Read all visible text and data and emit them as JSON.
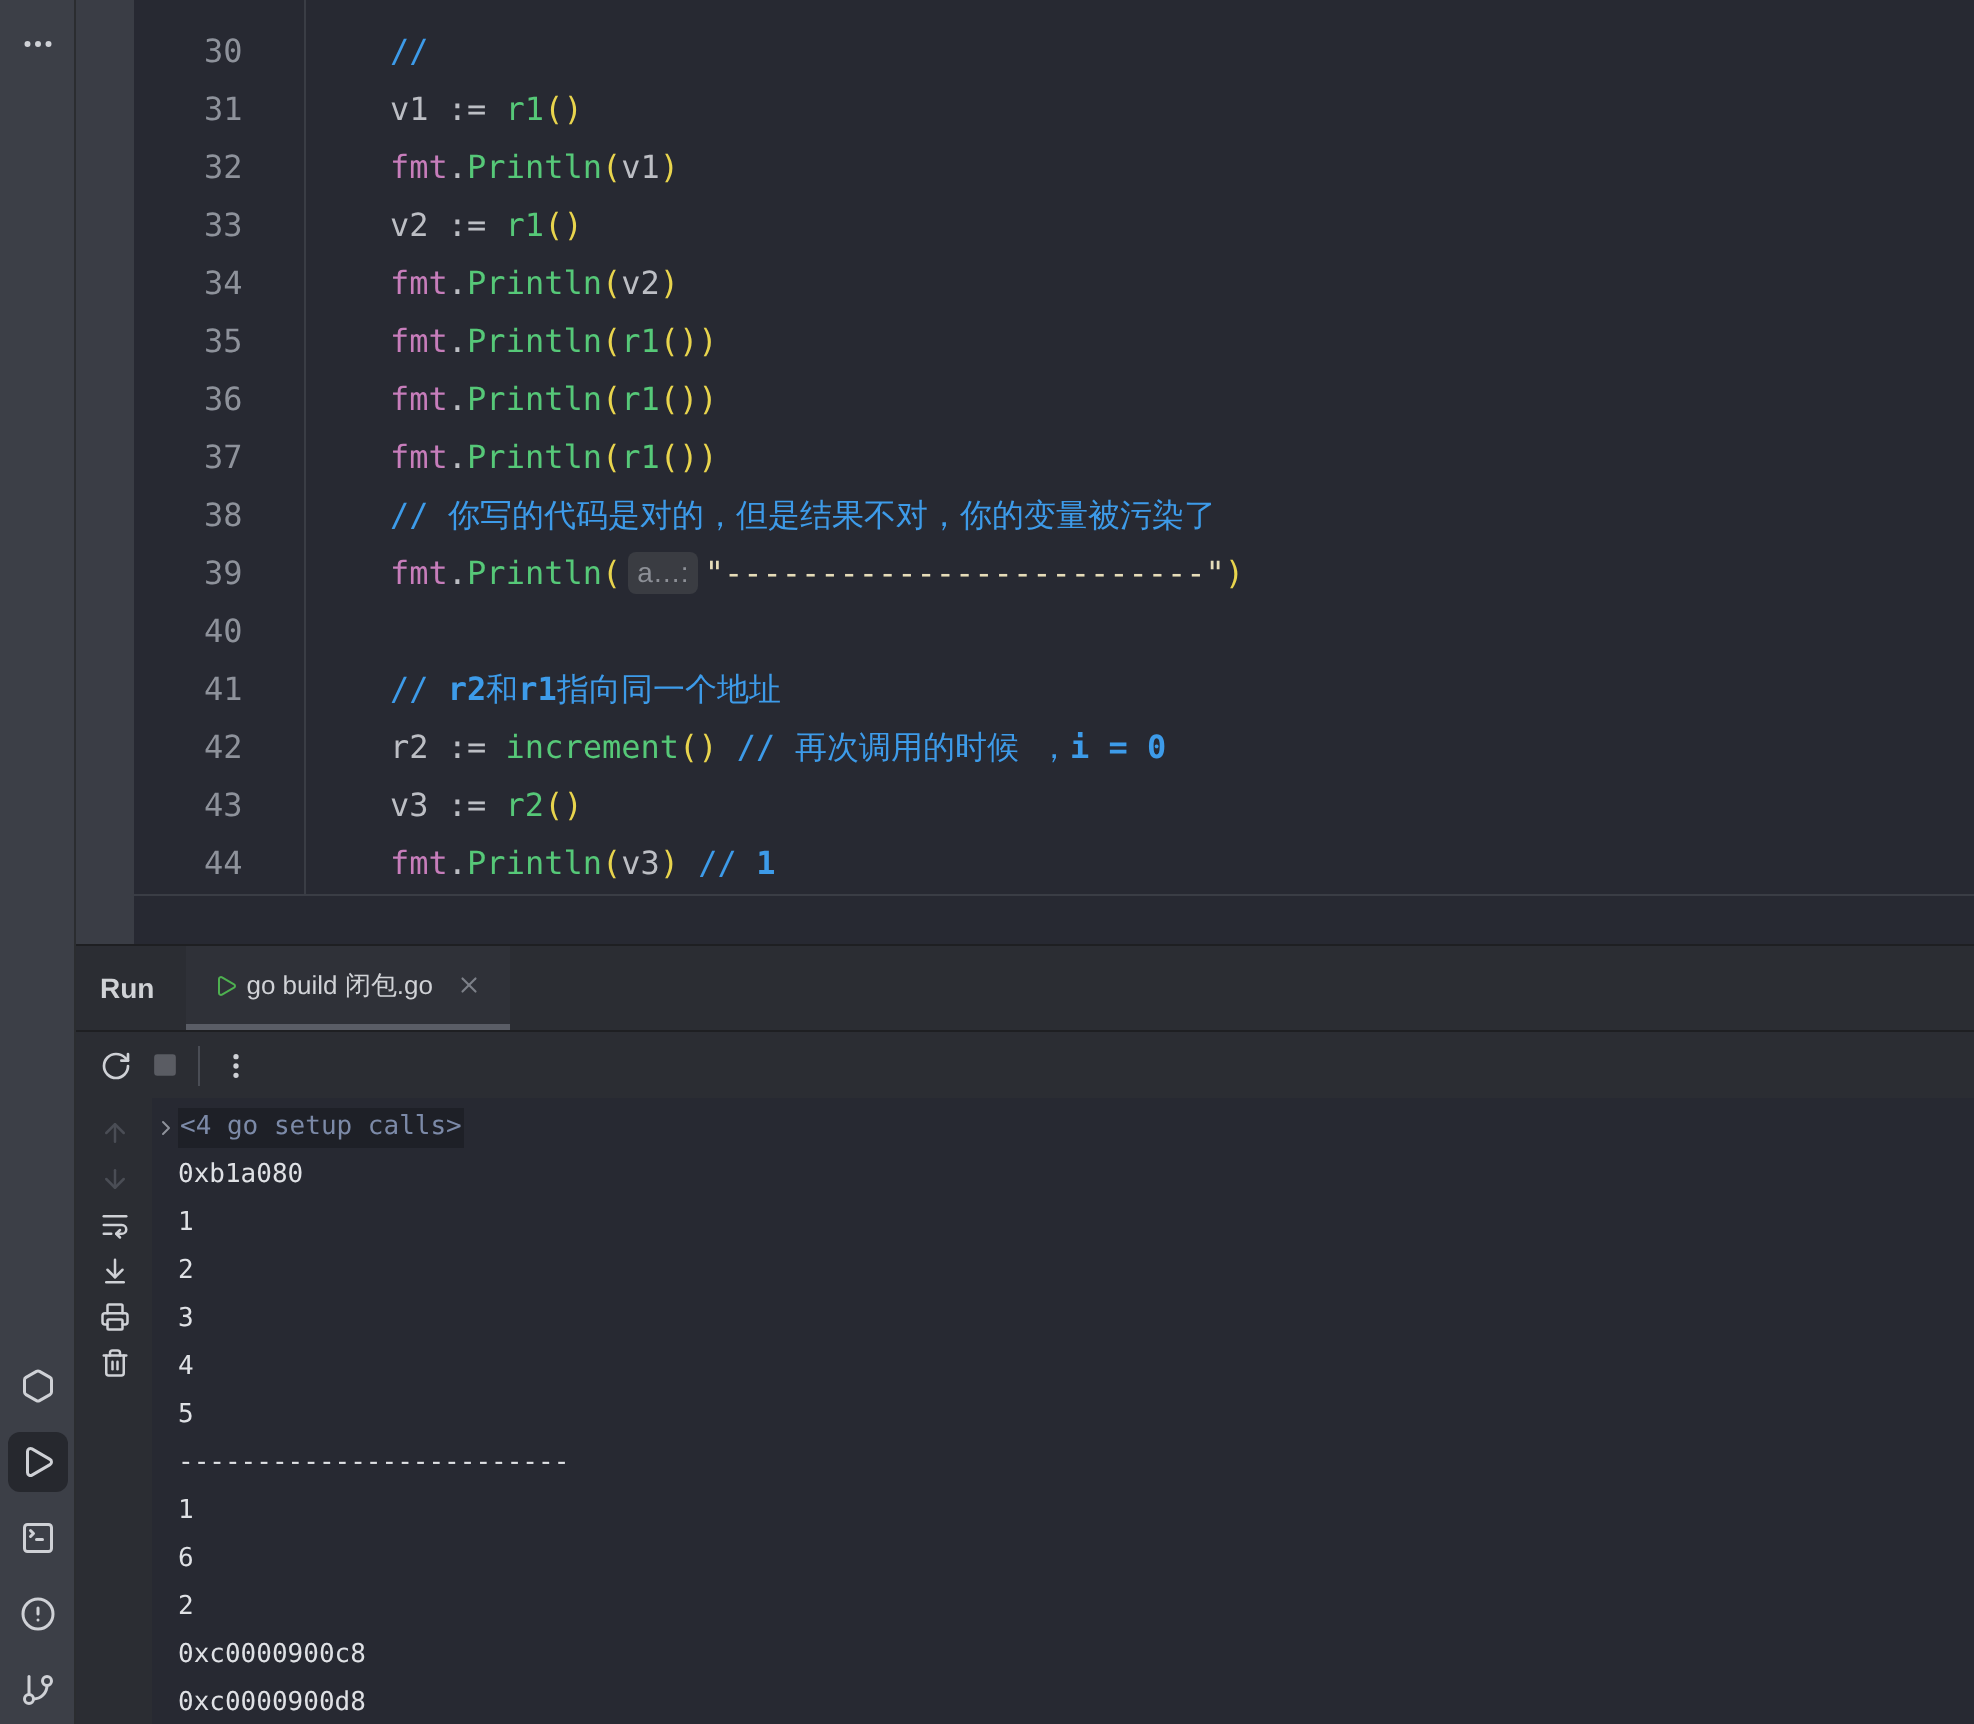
{
  "code_lines": [
    {
      "number": "30",
      "tokens": [
        {
          "kind": "comment",
          "text": "//"
        }
      ]
    },
    {
      "number": "31",
      "tokens": [
        {
          "kind": "ident",
          "text": "v1 := "
        },
        {
          "kind": "func",
          "text": "r1"
        },
        {
          "kind": "paren",
          "text": "()"
        }
      ]
    },
    {
      "number": "32",
      "tokens": [
        {
          "kind": "pkg",
          "text": "fmt"
        },
        {
          "kind": "ident",
          "text": "."
        },
        {
          "kind": "func",
          "text": "Println"
        },
        {
          "kind": "paren",
          "text": "("
        },
        {
          "kind": "ident",
          "text": "v1"
        },
        {
          "kind": "paren",
          "text": ")"
        }
      ]
    },
    {
      "number": "33",
      "tokens": [
        {
          "kind": "ident",
          "text": "v2 := "
        },
        {
          "kind": "func",
          "text": "r1"
        },
        {
          "kind": "paren",
          "text": "()"
        }
      ]
    },
    {
      "number": "34",
      "tokens": [
        {
          "kind": "pkg",
          "text": "fmt"
        },
        {
          "kind": "ident",
          "text": "."
        },
        {
          "kind": "func",
          "text": "Println"
        },
        {
          "kind": "paren",
          "text": "("
        },
        {
          "kind": "ident",
          "text": "v2"
        },
        {
          "kind": "paren",
          "text": ")"
        }
      ]
    },
    {
      "number": "35",
      "tokens": [
        {
          "kind": "pkg",
          "text": "fmt"
        },
        {
          "kind": "ident",
          "text": "."
        },
        {
          "kind": "func",
          "text": "Println"
        },
        {
          "kind": "paren",
          "text": "("
        },
        {
          "kind": "func",
          "text": "r1"
        },
        {
          "kind": "paren",
          "text": "())"
        }
      ]
    },
    {
      "number": "36",
      "tokens": [
        {
          "kind": "pkg",
          "text": "fmt"
        },
        {
          "kind": "ident",
          "text": "."
        },
        {
          "kind": "func",
          "text": "Println"
        },
        {
          "kind": "paren",
          "text": "("
        },
        {
          "kind": "func",
          "text": "r1"
        },
        {
          "kind": "paren",
          "text": "())"
        }
      ]
    },
    {
      "number": "37",
      "tokens": [
        {
          "kind": "pkg",
          "text": "fmt"
        },
        {
          "kind": "ident",
          "text": "."
        },
        {
          "kind": "func",
          "text": "Println"
        },
        {
          "kind": "paren",
          "text": "("
        },
        {
          "kind": "func",
          "text": "r1"
        },
        {
          "kind": "paren",
          "text": "())"
        }
      ]
    },
    {
      "number": "38",
      "tokens": [
        {
          "kind": "comment",
          "text": "// 你写的代码是对的，但是结果不对，你的变量被污染了"
        }
      ]
    },
    {
      "number": "39",
      "tokens": [
        {
          "kind": "pkg",
          "text": "fmt"
        },
        {
          "kind": "ident",
          "text": "."
        },
        {
          "kind": "func",
          "text": "Println"
        },
        {
          "kind": "paren",
          "text": "("
        },
        {
          "kind": "hint",
          "text": "a…:"
        },
        {
          "kind": "string",
          "text": "\"-------------------------\""
        },
        {
          "kind": "paren",
          "text": ")"
        }
      ]
    },
    {
      "number": "40"
    },
    {
      "number": "41",
      "tokens": [
        {
          "kind": "comment",
          "text": "// **r2**和**r1**指向同一个地址"
        }
      ]
    },
    {
      "number": "42",
      "tokens": [
        {
          "kind": "ident",
          "text": "r2 := "
        },
        {
          "kind": "func",
          "text": "increment"
        },
        {
          "kind": "paren",
          "text": "()"
        },
        {
          "kind": "comment",
          "text": " // 再次调用的时候 ，**i = 0**"
        }
      ]
    },
    {
      "number": "43",
      "tokens": [
        {
          "kind": "ident",
          "text": "v3 := "
        },
        {
          "kind": "func",
          "text": "r2"
        },
        {
          "kind": "paren",
          "text": "()"
        }
      ]
    },
    {
      "number": "44",
      "tokens": [
        {
          "kind": "pkg",
          "text": "fmt"
        },
        {
          "kind": "ident",
          "text": "."
        },
        {
          "kind": "func",
          "text": "Println"
        },
        {
          "kind": "paren",
          "text": "("
        },
        {
          "kind": "ident",
          "text": "v3"
        },
        {
          "kind": "paren",
          "text": ")"
        },
        {
          "kind": "comment",
          "text": " // **1**"
        }
      ]
    }
  ],
  "run_panel": {
    "title": "Run",
    "tabs": [
      {
        "label": "go build 闭包.go",
        "selected": true
      }
    ],
    "folded_group": "<4 go setup calls>",
    "output": [
      "0xb1a080",
      "1",
      "2",
      "3",
      "4",
      "5",
      "-------------------------",
      "1",
      "6",
      "2",
      "0xc0000900c8",
      "0xc0000900d8"
    ]
  },
  "tool_strip": [
    {
      "kind": "services",
      "selected": false
    },
    {
      "kind": "run",
      "selected": true
    },
    {
      "kind": "terminal",
      "selected": false
    },
    {
      "kind": "problems",
      "selected": false
    },
    {
      "kind": "git",
      "selected": false
    }
  ]
}
